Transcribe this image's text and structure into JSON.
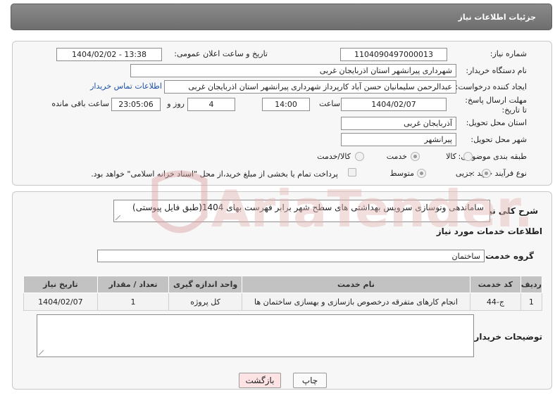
{
  "header": {
    "title": "جزئیات اطلاعات نیاز"
  },
  "form": {
    "need_number": {
      "label": "شماره نیاز:",
      "value": "1104090497000013"
    },
    "announce_datetime": {
      "label": "تاریخ و ساعت اعلان عمومی:",
      "value": "1404/02/02 - 13:38"
    },
    "buyer_org": {
      "label": "نام دستگاه خریدار:",
      "value": "شهرداری پیرانشهر استان اذربایجان غربی"
    },
    "creator": {
      "label": "ایجاد کننده درخواست:",
      "value": "عبدالرحمن سلیمانیان حسن آباد کارپرداز شهرداری پیرانشهر استان اذربایجان غربی",
      "contact_link": "اطلاعات تماس خریدار"
    },
    "deadline": {
      "label": "مهلت ارسال پاسخ: تا تاریخ:",
      "date": "1404/02/07",
      "time_label": "ساعت",
      "time": "14:00",
      "days": "4",
      "days_label": "روز و",
      "remaining": "23:05:06",
      "remaining_label": "ساعت باقی مانده"
    },
    "province": {
      "label": "استان محل تحویل:",
      "value": "آذربایجان غربی"
    },
    "city": {
      "label": "شهر محل تحویل:",
      "value": "پیرانشهر"
    },
    "category": {
      "label": "طبقه بندی موضوعی:",
      "options": [
        "کالا",
        "خدمت",
        "کالا/خدمت"
      ],
      "selected": "خدمت"
    },
    "process_type": {
      "label": "نوع فرآیند خرید :",
      "options": [
        "جزیی",
        "متوسط"
      ],
      "selected": "جزیی",
      "payment_note": "پرداخت تمام یا بخشی از مبلغ خرید،از محل \"اسناد خزانه اسلامی\" خواهد بود."
    }
  },
  "description": {
    "label": "شرح کلی نیاز:",
    "value": "ساماندهی ونوسازی سرویس بهداشتی های سطح شهر برابر فهرست بهای  1404(طبق فایل پیوستی)"
  },
  "services": {
    "section_title": "اطلاعات خدمات مورد نیاز",
    "group_label": "گروه خدمت:",
    "group_value": "ساختمان",
    "columns": [
      "ردیف",
      "کد خدمت",
      "نام خدمت",
      "واحد اندازه گیری",
      "تعداد / مقدار",
      "تاریخ نیاز"
    ],
    "rows": [
      [
        "1",
        "ج-44",
        "انجام کارهای متفرقه درخصوص بازسازی و بهسازی ساختمان ها",
        "کل پروژه",
        "1",
        "1404/02/07"
      ]
    ]
  },
  "buyer_notes": {
    "label": "توضیحات خریدار:",
    "value": ""
  },
  "buttons": {
    "print": "چاپ",
    "back": "بازگشت"
  },
  "watermark": {
    "text": "AriaTender.neT",
    "color": "#e6b8b8"
  }
}
